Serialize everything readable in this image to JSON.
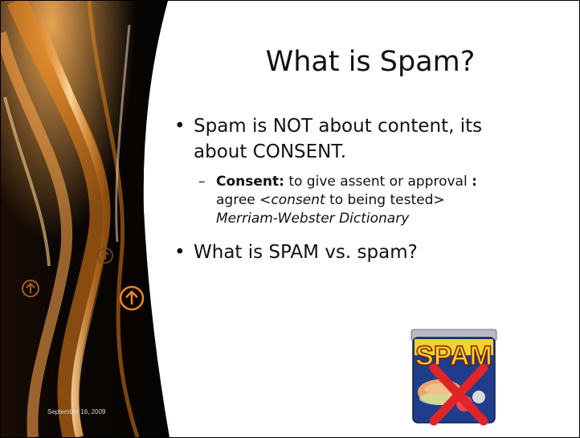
{
  "slide": {
    "title": "What is Spam?",
    "date": "September 16, 2009",
    "bullet1_line1": "Spam is NOT about content, its",
    "bullet1_line2": "about CONSENT.",
    "sub_term": "Consent:",
    "sub_def1": " to give assent or approval ",
    "sub_colon": ":",
    "sub_def2_pre": "agree <",
    "sub_def2_em": "consent",
    "sub_def2_post": " to being tested>",
    "sub_source": "Merriam-Webster Dictionary",
    "bullet2": "What is SPAM vs. spam?",
    "bullet_glyph": "•",
    "dash_glyph": "–",
    "can_label": "SPAM"
  },
  "colors": {
    "accent": "#f0861c",
    "dark": "#0b0603",
    "forbid": "#e0242a"
  }
}
